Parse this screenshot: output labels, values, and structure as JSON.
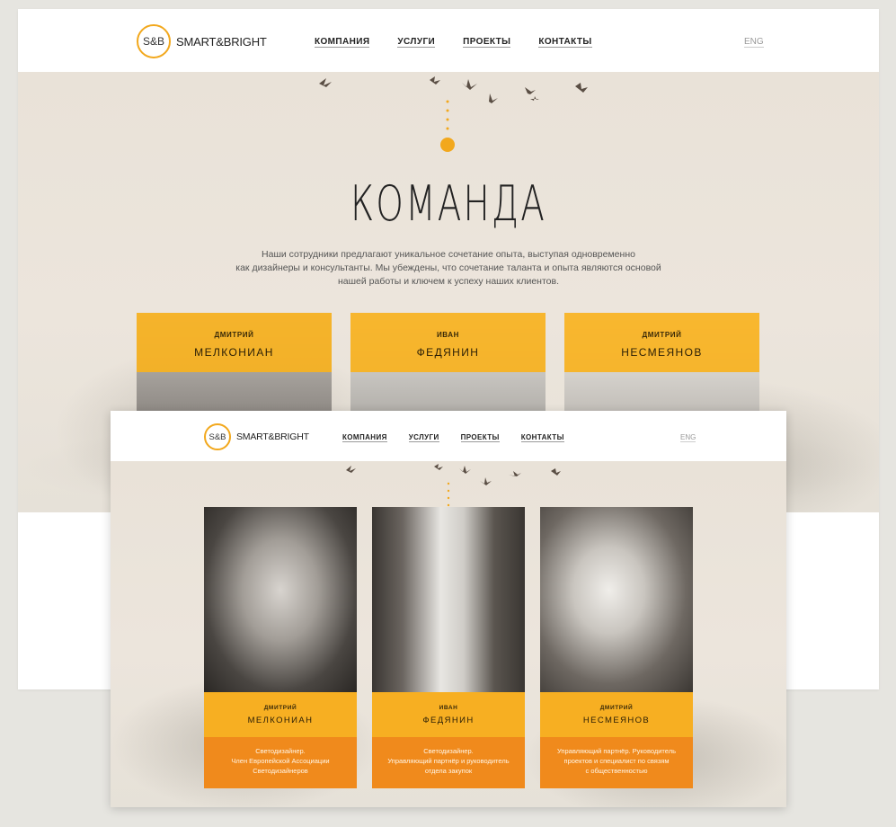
{
  "brand": {
    "mark": "S&B",
    "name": "SMART&BRIGHT"
  },
  "nav": {
    "items": [
      "КОМПАНИЯ",
      "УСЛУГИ",
      "ПРОЕКТЫ",
      "КОНТАКТЫ"
    ],
    "lang": "ENG"
  },
  "hero": {
    "title": "КОМАНДА",
    "intro_lines": [
      "Наши сотрудники предлагают уникальное сочетание опыта,  выступая одновременно",
      "как дизайнеры и консультанты. Мы убеждены, что сочетание таланта и опыта являются основой",
      "нашей работы и ключем к успеху наших клиентов."
    ]
  },
  "team": [
    {
      "first": "ДМИТРИЙ",
      "last": "МЕЛКОНИАН",
      "role_lines": [
        "Светодизайнер.",
        "Член Европейской Ассоциации",
        "Светодизайнеров"
      ]
    },
    {
      "first": "ИВАН",
      "last": "ФЕДЯНИН",
      "role_lines": [
        "Светодизайнер.",
        "Управляющий партнёр и руководитель",
        "отдела закупок"
      ]
    },
    {
      "first": "ДМИТРИЙ",
      "last": "НЕСМЕЯНОВ",
      "role_lines": [
        "Управляющий партнёр. Руководитель",
        "проектов и специалист по связям",
        "с общественностью"
      ]
    }
  ],
  "colors": {
    "accent": "#f8b21e",
    "role_band": "#f08a1c",
    "hero_bg": "#ebe4da"
  }
}
